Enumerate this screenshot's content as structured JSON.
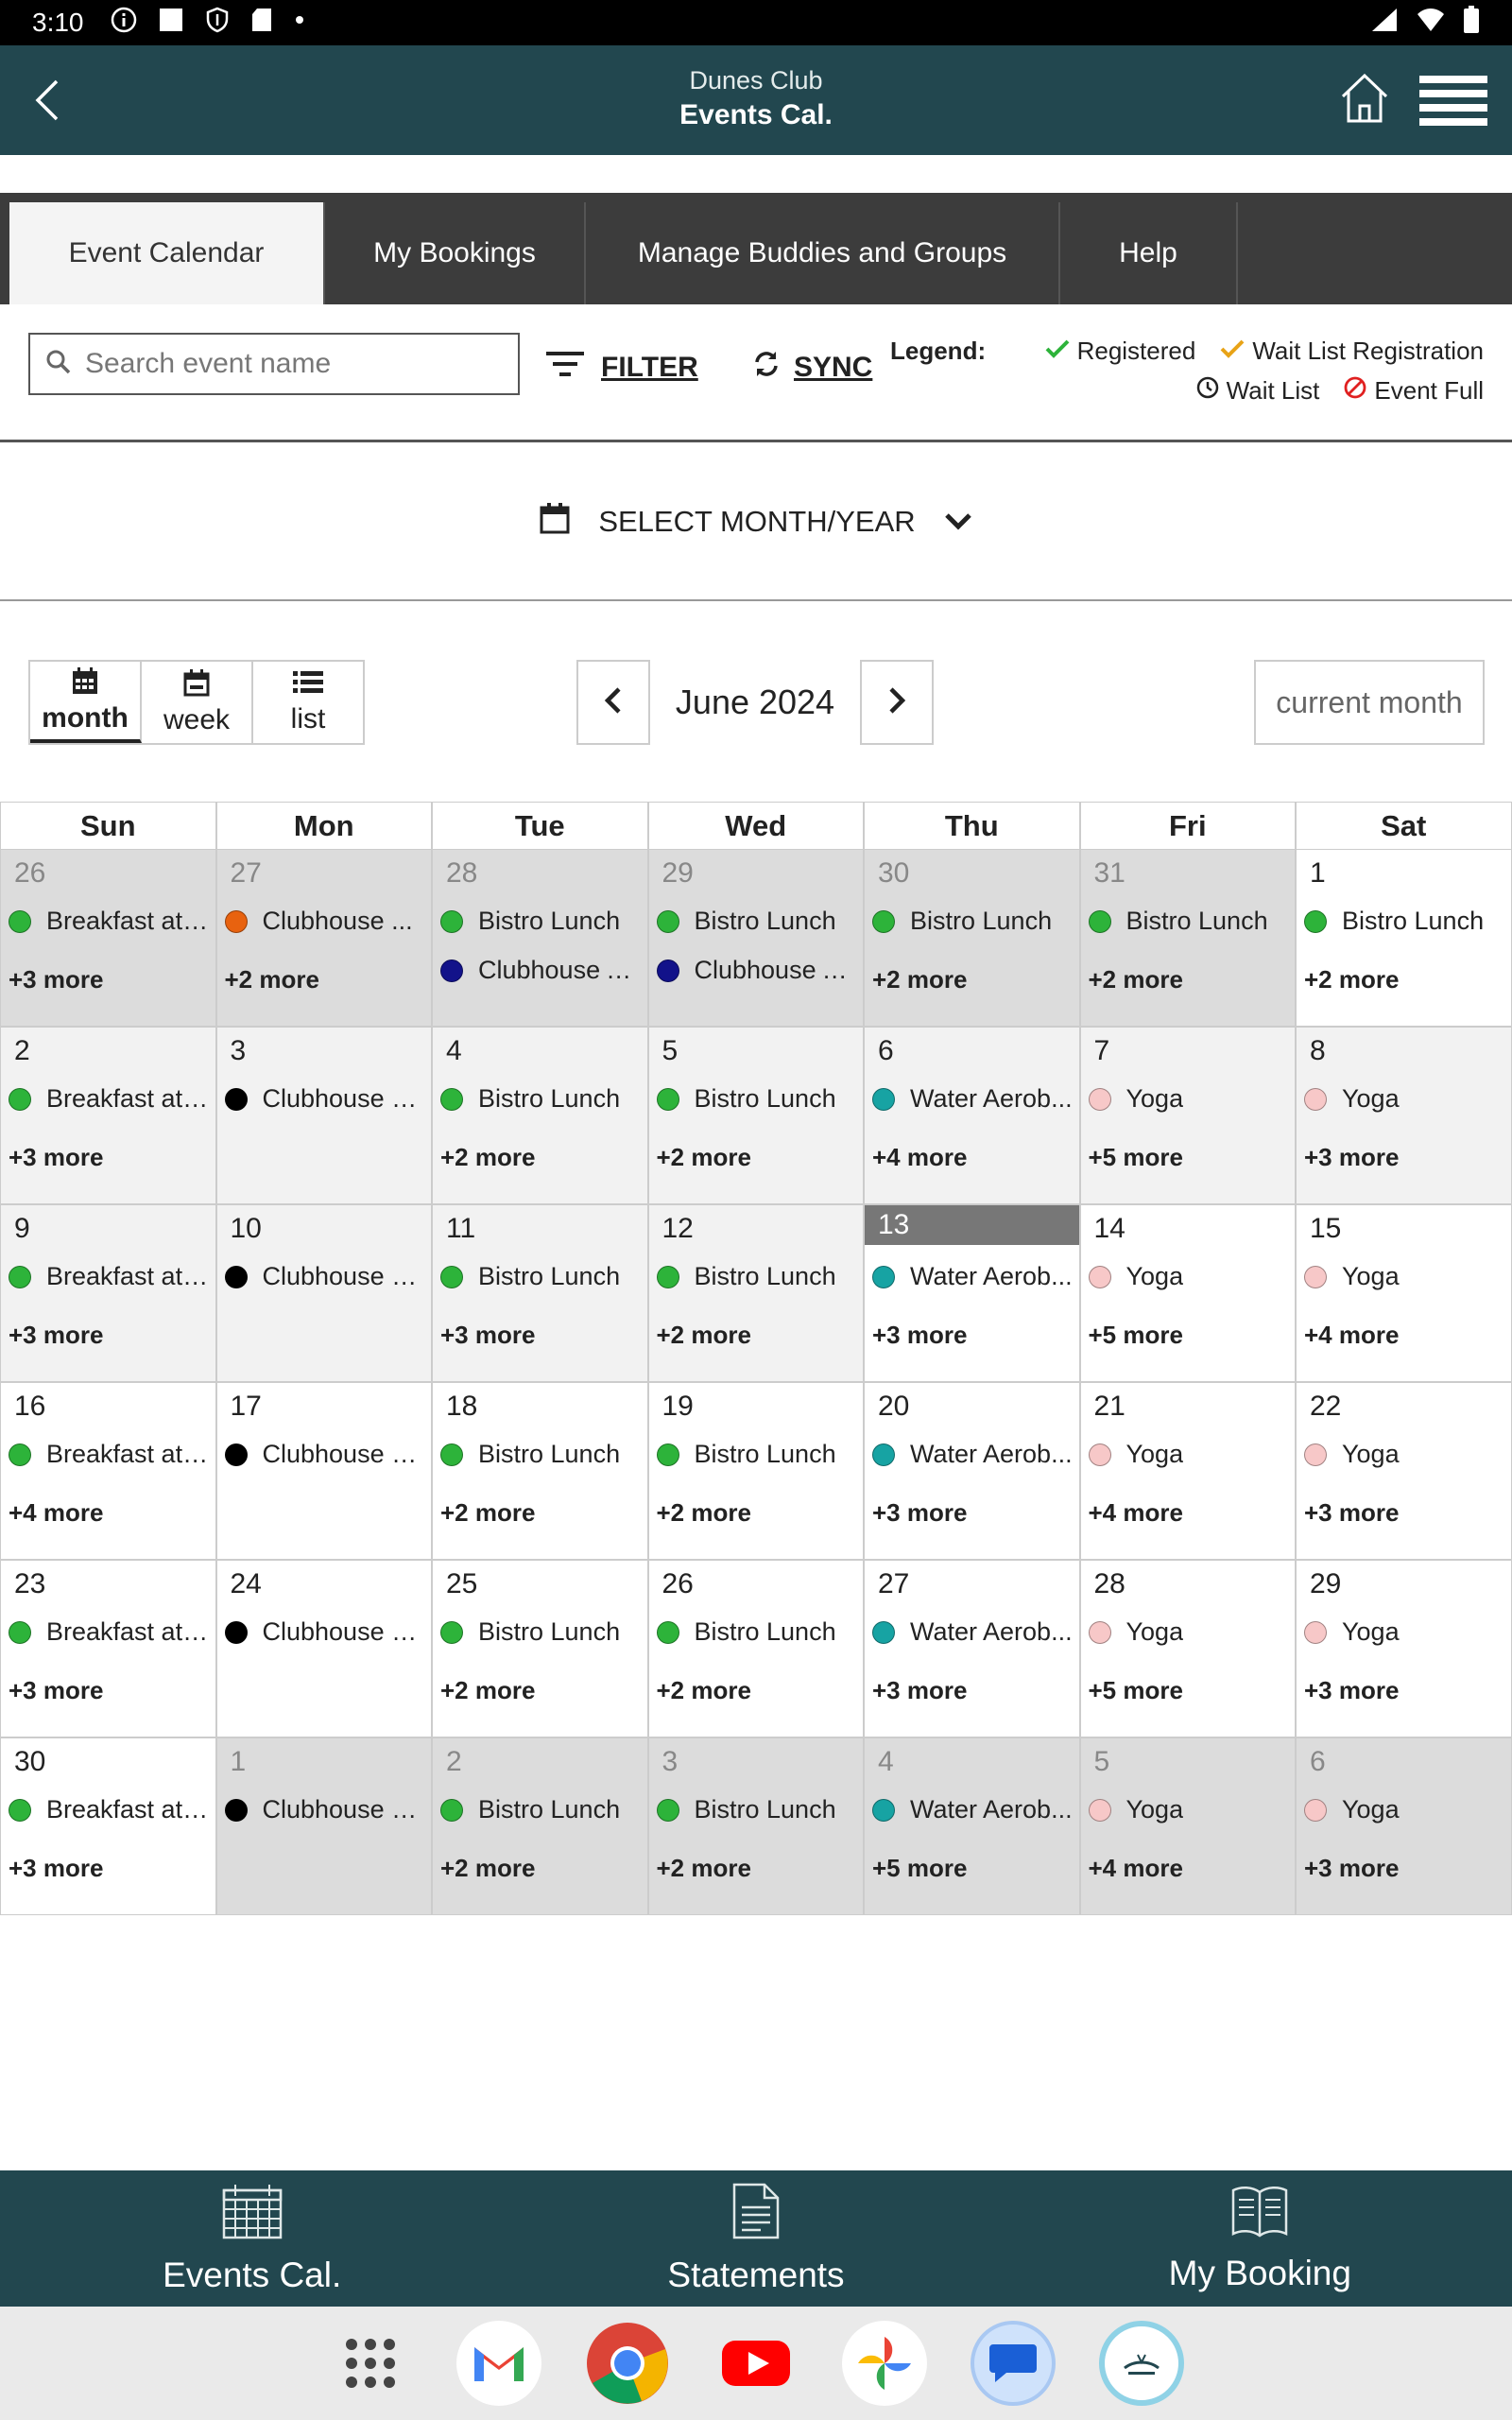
{
  "status_bar": {
    "time": "3:10"
  },
  "header": {
    "club_name": "Dunes Club",
    "title": "Events Cal."
  },
  "tabs": [
    {
      "label": "Event Calendar",
      "active": true
    },
    {
      "label": "My Bookings"
    },
    {
      "label": "Manage Buddies and Groups"
    },
    {
      "label": "Help"
    }
  ],
  "toolbar": {
    "search_placeholder": "Search event name",
    "filter_label": "FILTER",
    "sync_label": "SYNC",
    "legend_title": "Legend:",
    "legend": [
      {
        "label": "Registered",
        "icon": "check-icon",
        "color": "#2db33a"
      },
      {
        "label": "Wait List Registration",
        "icon": "check-icon",
        "color": "#e8a317"
      },
      {
        "label": "Wait List",
        "icon": "clock-icon",
        "color": "#222222"
      },
      {
        "label": "Event Full",
        "icon": "no-entry-icon",
        "color": "#e02020"
      }
    ]
  },
  "month_select": {
    "label": "SELECT MONTH/YEAR"
  },
  "views": [
    {
      "label": "month",
      "active": true
    },
    {
      "label": "week"
    },
    {
      "label": "list"
    }
  ],
  "nav": {
    "month_label": "June 2024",
    "current_month_label": "current month"
  },
  "colors": {
    "header_bg": "#22474f",
    "green": "#2db33a",
    "orange": "#e8620f",
    "navy": "#12128a",
    "black": "#000000",
    "teal": "#17a3a3",
    "pink": "#f7c8c8"
  },
  "calendar": {
    "days_of_week": [
      "Sun",
      "Mon",
      "Tue",
      "Wed",
      "Thu",
      "Fri",
      "Sat"
    ],
    "cells": [
      {
        "day": "26",
        "other": true,
        "events": [
          {
            "name": "Breakfast at ...",
            "color": "green"
          }
        ],
        "more": "+3 more"
      },
      {
        "day": "27",
        "other": true,
        "events": [
          {
            "name": "Clubhouse ...",
            "color": "orange"
          }
        ],
        "more": "+2 more"
      },
      {
        "day": "28",
        "other": true,
        "events": [
          {
            "name": "Bistro Lunch",
            "color": "green"
          },
          {
            "name": "Clubhouse A...",
            "color": "navy"
          }
        ],
        "more": ""
      },
      {
        "day": "29",
        "other": true,
        "events": [
          {
            "name": "Bistro Lunch",
            "color": "green"
          },
          {
            "name": "Clubhouse A...",
            "color": "navy"
          }
        ],
        "more": ""
      },
      {
        "day": "30",
        "other": true,
        "events": [
          {
            "name": "Bistro Lunch",
            "color": "green"
          }
        ],
        "more": "+2 more"
      },
      {
        "day": "31",
        "other": true,
        "events": [
          {
            "name": "Bistro Lunch",
            "color": "green"
          }
        ],
        "more": "+2 more"
      },
      {
        "day": "1",
        "events": [
          {
            "name": "Bistro Lunch",
            "color": "green"
          }
        ],
        "more": "+2 more"
      },
      {
        "day": "2",
        "wk": true,
        "events": [
          {
            "name": "Breakfast at ...",
            "color": "green"
          }
        ],
        "more": "+3 more"
      },
      {
        "day": "3",
        "wk": true,
        "events": [
          {
            "name": "Clubhouse &...",
            "color": "black"
          }
        ],
        "more": ""
      },
      {
        "day": "4",
        "wk": true,
        "events": [
          {
            "name": "Bistro Lunch",
            "color": "green"
          }
        ],
        "more": "+2 more"
      },
      {
        "day": "5",
        "wk": true,
        "events": [
          {
            "name": "Bistro Lunch",
            "color": "green"
          }
        ],
        "more": "+2 more"
      },
      {
        "day": "6",
        "wk": true,
        "events": [
          {
            "name": "Water Aerob...",
            "color": "teal"
          }
        ],
        "more": "+4 more"
      },
      {
        "day": "7",
        "wk": true,
        "events": [
          {
            "name": "Yoga",
            "color": "pink"
          }
        ],
        "more": "+5 more"
      },
      {
        "day": "8",
        "wk": true,
        "events": [
          {
            "name": "Yoga",
            "color": "pink"
          }
        ],
        "more": "+3 more"
      },
      {
        "day": "9",
        "wk": true,
        "events": [
          {
            "name": "Breakfast at ...",
            "color": "green"
          }
        ],
        "more": "+3 more"
      },
      {
        "day": "10",
        "wk": true,
        "events": [
          {
            "name": "Clubhouse &...",
            "color": "black"
          }
        ],
        "more": ""
      },
      {
        "day": "11",
        "wk": true,
        "events": [
          {
            "name": "Bistro Lunch",
            "color": "green"
          }
        ],
        "more": "+3 more"
      },
      {
        "day": "12",
        "wk": true,
        "events": [
          {
            "name": "Bistro Lunch",
            "color": "green"
          }
        ],
        "more": "+2 more"
      },
      {
        "day": "13",
        "today": true,
        "events": [
          {
            "name": "Water Aerob...",
            "color": "teal"
          }
        ],
        "more": "+3 more"
      },
      {
        "day": "14",
        "events": [
          {
            "name": "Yoga",
            "color": "pink"
          }
        ],
        "more": "+5 more"
      },
      {
        "day": "15",
        "events": [
          {
            "name": "Yoga",
            "color": "pink"
          }
        ],
        "more": "+4 more"
      },
      {
        "day": "16",
        "events": [
          {
            "name": "Breakfast at ...",
            "color": "green"
          }
        ],
        "more": "+4 more"
      },
      {
        "day": "17",
        "events": [
          {
            "name": "Clubhouse &...",
            "color": "black"
          }
        ],
        "more": ""
      },
      {
        "day": "18",
        "events": [
          {
            "name": "Bistro Lunch",
            "color": "green"
          }
        ],
        "more": "+2 more"
      },
      {
        "day": "19",
        "events": [
          {
            "name": "Bistro Lunch",
            "color": "green"
          }
        ],
        "more": "+2 more"
      },
      {
        "day": "20",
        "events": [
          {
            "name": "Water Aerob...",
            "color": "teal"
          }
        ],
        "more": "+3 more"
      },
      {
        "day": "21",
        "events": [
          {
            "name": "Yoga",
            "color": "pink"
          }
        ],
        "more": "+4 more"
      },
      {
        "day": "22",
        "events": [
          {
            "name": "Yoga",
            "color": "pink"
          }
        ],
        "more": "+3 more"
      },
      {
        "day": "23",
        "events": [
          {
            "name": "Breakfast at ...",
            "color": "green"
          }
        ],
        "more": "+3 more"
      },
      {
        "day": "24",
        "events": [
          {
            "name": "Clubhouse &...",
            "color": "black"
          }
        ],
        "more": ""
      },
      {
        "day": "25",
        "events": [
          {
            "name": "Bistro Lunch",
            "color": "green"
          }
        ],
        "more": "+2 more"
      },
      {
        "day": "26",
        "events": [
          {
            "name": "Bistro Lunch",
            "color": "green"
          }
        ],
        "more": "+2 more"
      },
      {
        "day": "27",
        "events": [
          {
            "name": "Water Aerob...",
            "color": "teal"
          }
        ],
        "more": "+3 more"
      },
      {
        "day": "28",
        "events": [
          {
            "name": "Yoga",
            "color": "pink"
          }
        ],
        "more": "+5 more"
      },
      {
        "day": "29",
        "events": [
          {
            "name": "Yoga",
            "color": "pink"
          }
        ],
        "more": "+3 more"
      },
      {
        "day": "30",
        "events": [
          {
            "name": "Breakfast at ...",
            "color": "green"
          }
        ],
        "more": "+3 more"
      },
      {
        "day": "1",
        "other": true,
        "events": [
          {
            "name": "Clubhouse &...",
            "color": "black"
          }
        ],
        "more": ""
      },
      {
        "day": "2",
        "other": true,
        "events": [
          {
            "name": "Bistro Lunch",
            "color": "green"
          }
        ],
        "more": "+2 more"
      },
      {
        "day": "3",
        "other": true,
        "events": [
          {
            "name": "Bistro Lunch",
            "color": "green"
          }
        ],
        "more": "+2 more"
      },
      {
        "day": "4",
        "other": true,
        "events": [
          {
            "name": "Water Aerob...",
            "color": "teal"
          }
        ],
        "more": "+5 more"
      },
      {
        "day": "5",
        "other": true,
        "events": [
          {
            "name": "Yoga",
            "color": "pink"
          }
        ],
        "more": "+4 more"
      },
      {
        "day": "6",
        "other": true,
        "events": [
          {
            "name": "Yoga",
            "color": "pink"
          }
        ],
        "more": "+3 more"
      }
    ]
  },
  "bottom_nav": [
    {
      "label": "Events Cal.",
      "icon": "calendar-grid-icon"
    },
    {
      "label": "Statements",
      "icon": "document-icon"
    },
    {
      "label": "My Booking",
      "icon": "book-icon"
    }
  ],
  "dock_apps": [
    "app-drawer-icon",
    "gmail-icon",
    "chrome-icon",
    "youtube-icon",
    "photos-icon",
    "messages-icon",
    "dunes-club-app-icon"
  ]
}
